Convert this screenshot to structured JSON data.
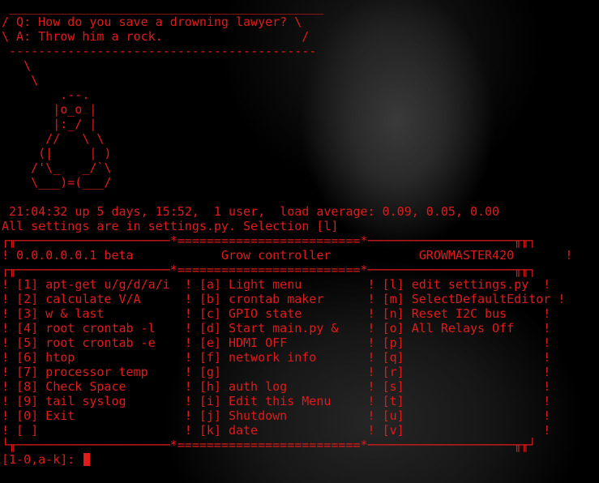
{
  "cowsay": {
    "bubble": [
      " ___________________________________________",
      "/ Q: How do you save a drowning lawyer? \\",
      "\\ A: Throw him a rock.                   /",
      " ------------------------------------------"
    ],
    "tux": [
      "   \\",
      "    \\",
      "        .--.",
      "       |o_o |",
      "       |:_/ |",
      "      //   \\ \\",
      "     (|     | )",
      "    /'\\_   _/`\\",
      "    \\___)=(___/"
    ]
  },
  "uptime": " 21:04:32 up 5 days, 15:52,  1 user,  load average: 0.09, 0.05, 0.00",
  "settings_note": "All settings are in settings.py. Selection [l]",
  "menu": {
    "top_border": "┌╥─────────────────────*=========================*────────────────────╥╥┐",
    "header": "! 0.0.0.0.0.1 beta            Grow controller            GROWMASTER420       !",
    "mid_border": "┌╥─────────────────────*=========================*────────────────────╥╥┐",
    "rows": [
      "! [1] apt-get u/g/d/a/i  ! [a] Light menu         ! [l] edit settings.py  !",
      "! [2] calculate V/A      ! [b] crontab maker      ! [m] SelectDefaultEditor !",
      "! [3] w & last           ! [c] GPIO state         ! [n] Reset I2C bus     !",
      "! [4] root crontab -l    ! [d] Start main.py &    ! [o] All Relays Off    !",
      "! [5] root crontab -e    ! [e] HDMI OFF           ! [p]                   !",
      "! [6] htop               ! [f] network info       ! [q]                   !",
      "! [7] processor temp     ! [g]                    ! [r]                   !",
      "! [8] Check Space        ! [h] auth log           ! [s]                   !",
      "! [9] tail syslog        ! [i] Edit this Menu     ! [t]                   !",
      "! [0] Exit               ! [j] Shutdown           ! [u]                   !",
      "! [ ]                    ! [k] date               ! [v]                   !"
    ],
    "bottom_border": "└╥─────────────────────*=========================*────────────────────╥╥┘"
  },
  "prompt": "[1-0,a-k]: ",
  "colors": {
    "fg": "#e01b1b",
    "bg": "#000000"
  }
}
